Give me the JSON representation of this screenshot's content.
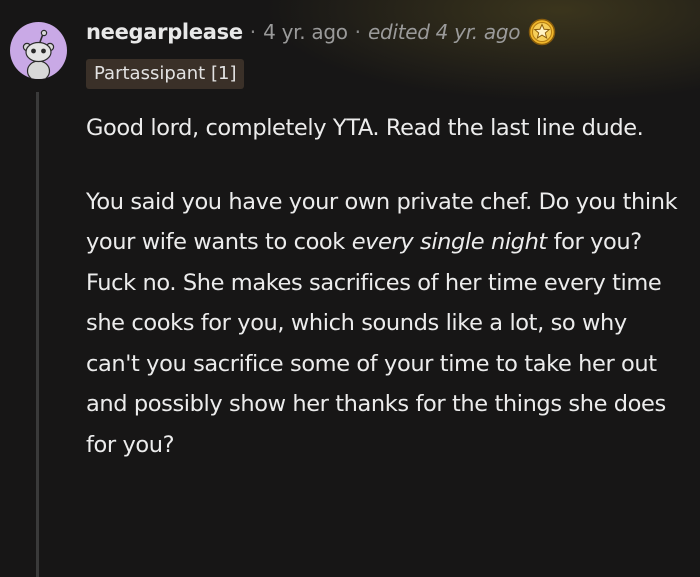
{
  "comment": {
    "author": "neegarplease",
    "separator": "·",
    "posted_ago": "4 yr. ago",
    "edited": "edited 4 yr. ago",
    "flair": "Partassipant [1]",
    "avatar_icon": "snoo-avatar-icon",
    "award_icon": "award-icon",
    "paragraph1": "Good lord, completely YTA. Read the last line dude.",
    "paragraph2": {
      "part1": "You said you have your own private chef. Do you think your wife wants to cook ",
      "emphasis": "every single night",
      "part2": " for you? Fuck no. She makes sacrifices of her time every time she cooks for you, which sounds like a lot, so why can't you sacrifice some of your time to take her out and possibly show her thanks for the things she does for you?"
    }
  },
  "colors": {
    "background": "#171616",
    "avatar_bg": "#c9a9e6",
    "flair_bg": "#3a3028",
    "award_gold": "#f0b62b"
  }
}
